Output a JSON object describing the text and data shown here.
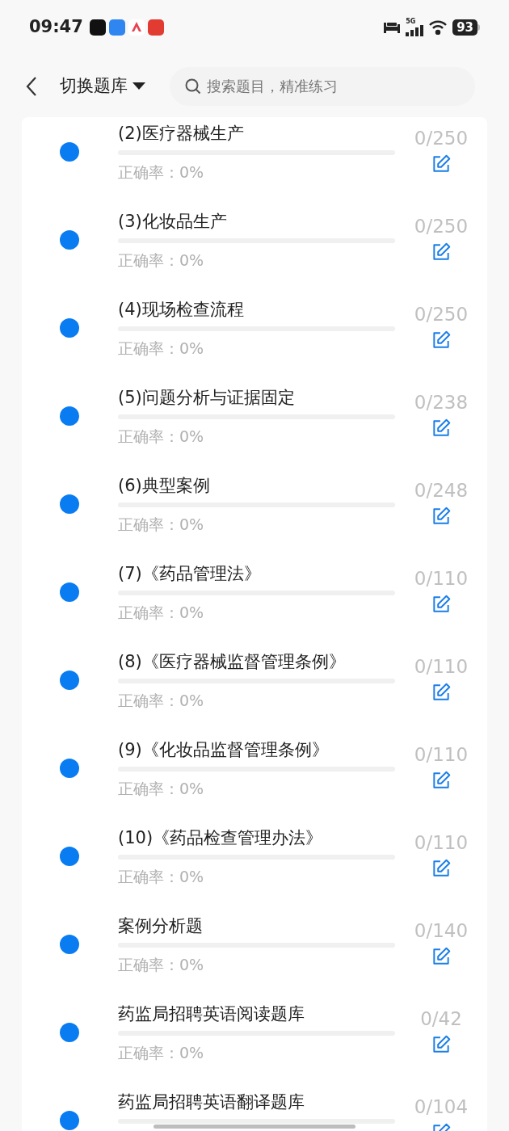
{
  "status_bar": {
    "time": "09:47",
    "network": "5G",
    "battery": "93"
  },
  "header": {
    "title": "切换题库",
    "search": {
      "placeholder": "搜索题目，精准练习"
    }
  },
  "banks": [
    {
      "title": "(2)医疗器械生产",
      "level": 0,
      "accuracy": "正确率：0%",
      "count": "0/250"
    },
    {
      "title": "(3)化妆品生产",
      "level": 0,
      "accuracy": "正确率：0%",
      "count": "0/250"
    },
    {
      "title": "(4)现场检查流程",
      "level": 0,
      "accuracy": "正确率：0%",
      "count": "0/250"
    },
    {
      "title": "(5)问题分析与证据固定",
      "level": 0,
      "accuracy": "正确率：0%",
      "count": "0/238"
    },
    {
      "title": "(6)典型案例",
      "level": 0,
      "accuracy": "正确率：0%",
      "count": "0/248"
    },
    {
      "title": "(7)《药品管理法》",
      "level": 0,
      "accuracy": "正确率：0%",
      "count": "0/110"
    },
    {
      "title": "(8)《医疗器械监督管理条例》",
      "level": 0,
      "accuracy": "正确率：0%",
      "count": "0/110"
    },
    {
      "title": "(9)《化妆品监督管理条例》",
      "level": 0,
      "accuracy": "正确率：0%",
      "count": "0/110"
    },
    {
      "title": "(10)《药品检查管理办法》",
      "level": 0,
      "accuracy": "正确率：0%",
      "count": "0/110"
    },
    {
      "title": "案例分析题",
      "level": 0,
      "accuracy": "正确率：0%",
      "count": "0/140"
    },
    {
      "title": "药监局招聘英语阅读题库",
      "level": 0,
      "accuracy": "正确率：0%",
      "count": "0/42"
    },
    {
      "title": "药监局招聘英语翻译题库",
      "level": 0,
      "count": "0/104"
    }
  ]
}
